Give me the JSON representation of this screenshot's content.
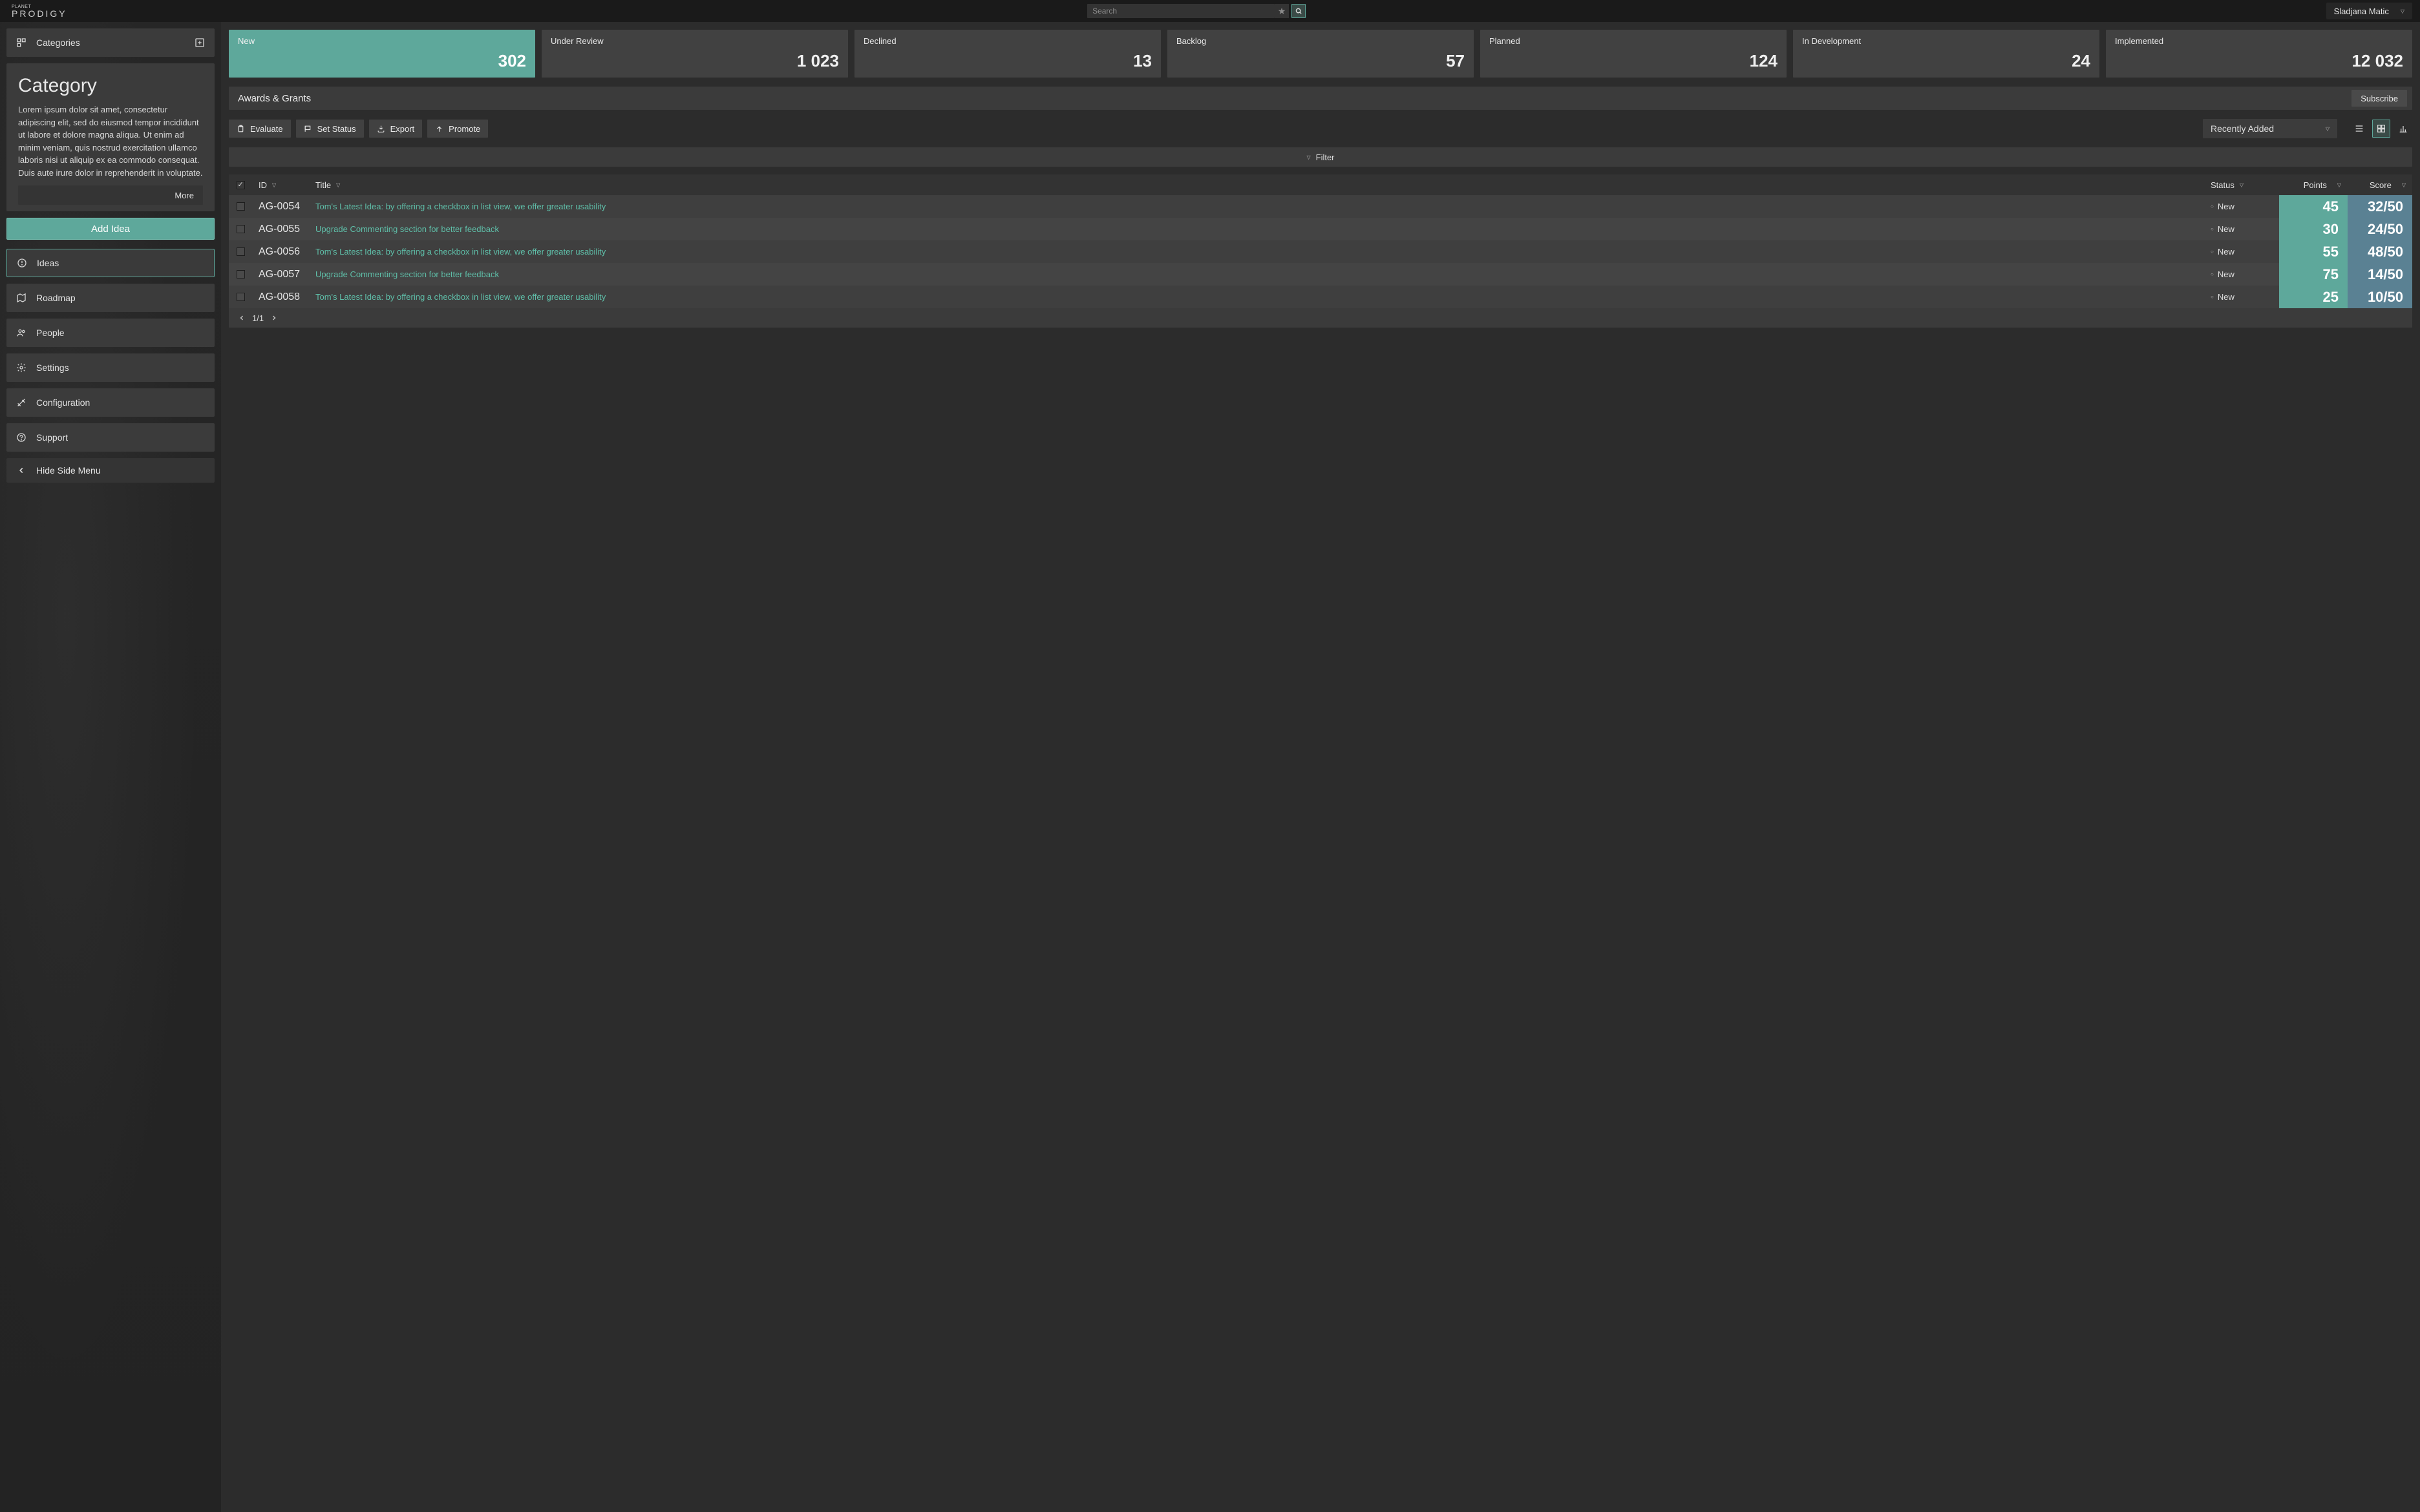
{
  "brand": {
    "small": "PLANET",
    "big": "PRODIGY"
  },
  "header": {
    "search_placeholder": "Search",
    "user": "Sladjana Matic"
  },
  "sidebar": {
    "categories_label": "Categories",
    "category": {
      "title": "Category",
      "desc": "Lorem ipsum dolor sit amet, consectetur adipiscing elit, sed do eiusmod tempor incididunt ut labore et dolore magna aliqua. Ut enim ad minim veniam, quis nostrud exercitation ullamco laboris nisi ut aliquip ex ea commodo consequat. Duis aute irure dolor in reprehenderit in voluptate.",
      "more": "More"
    },
    "add_idea": "Add Idea",
    "nav": {
      "ideas": "Ideas",
      "roadmap": "Roadmap",
      "people": "People",
      "settings": "Settings",
      "configuration": "Configuration",
      "support": "Support",
      "hide": "Hide Side Menu"
    }
  },
  "cards": [
    {
      "label": "New",
      "value": "302",
      "active": true
    },
    {
      "label": "Under Review",
      "value": "1 023"
    },
    {
      "label": "Declined",
      "value": "13"
    },
    {
      "label": "Backlog",
      "value": "57"
    },
    {
      "label": "Planned",
      "value": "124"
    },
    {
      "label": "In Development",
      "value": "24"
    },
    {
      "label": "Implemented",
      "value": "12 032"
    }
  ],
  "section": {
    "title": "Awards & Grants",
    "subscribe": "Subscribe"
  },
  "toolbar": {
    "evaluate": "Evaluate",
    "set_status": "Set Status",
    "export": "Export",
    "promote": "Promote",
    "sort": "Recently Added",
    "filter": "Filter"
  },
  "table": {
    "headers": {
      "id": "ID",
      "title": "Title",
      "status": "Status",
      "points": "Points",
      "score": "Score"
    },
    "rows": [
      {
        "id": "AG-0054",
        "title": "Tom's Latest Idea: by offering a checkbox in list view, we offer greater usability",
        "status": "New",
        "points": "45",
        "score": "32/50"
      },
      {
        "id": "AG-0055",
        "title": "Upgrade Commenting section for better feedback",
        "status": "New",
        "points": "30",
        "score": "24/50"
      },
      {
        "id": "AG-0056",
        "title": "Tom's Latest Idea: by offering a checkbox in list view, we offer greater usability",
        "status": "New",
        "points": "55",
        "score": "48/50"
      },
      {
        "id": "AG-0057",
        "title": "Upgrade Commenting section for better feedback",
        "status": "New",
        "points": "75",
        "score": "14/50"
      },
      {
        "id": "AG-0058",
        "title": "Tom's Latest Idea: by offering a checkbox in list view, we offer greater usability",
        "status": "New",
        "points": "25",
        "score": "10/50"
      }
    ],
    "pager": "1/1"
  }
}
